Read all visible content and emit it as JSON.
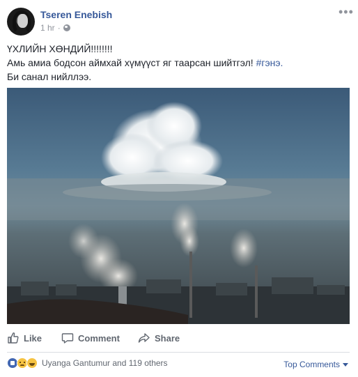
{
  "post": {
    "author": "Tseren Enebish",
    "time": "1 hr",
    "privacy_icon": "globe-icon",
    "options_icon": "ellipsis-icon",
    "text_lines": [
      "ҮХЛИЙН ХӨНДИЙ!!!!!!!!",
      "Амь амиа бодсон аймхай хүмүүст яг таарсан шийтгэл! ",
      "Би санал нийллээ."
    ],
    "hashtag": "#гэнэ."
  },
  "actions": {
    "like": "Like",
    "comment": "Comment",
    "share": "Share"
  },
  "reactions": {
    "icons": [
      "like-icon",
      "sad-icon",
      "haha-icon"
    ],
    "summary": "Uyanga Gantumur and 119 others",
    "top_comments": "Top Comments"
  }
}
